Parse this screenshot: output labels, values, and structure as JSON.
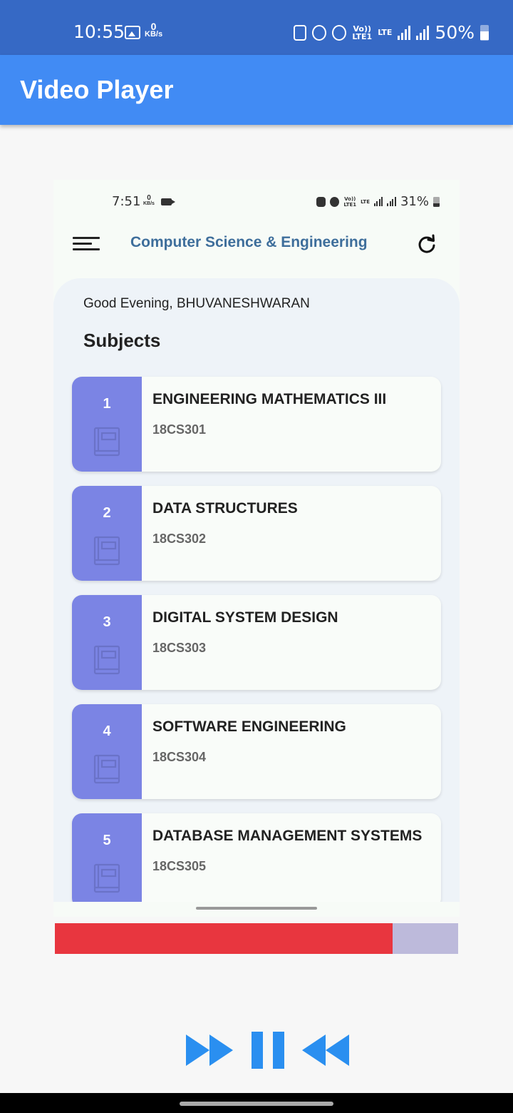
{
  "status_bar": {
    "time": "10:55",
    "data_rate_value": "0",
    "data_rate_unit": "KB/s",
    "network_top": "Vo))",
    "network_bottom": "LTE1",
    "lte": "LTE",
    "battery": "50%"
  },
  "app_bar": {
    "title": "Video Player"
  },
  "video": {
    "status_bar": {
      "time": "7:51",
      "data_rate_value": "0",
      "data_rate_unit": "KB/s",
      "network_top": "Vo))",
      "network_bottom": "LTE1",
      "lte": "LTE",
      "battery": "31%"
    },
    "header": {
      "title": "Computer Science & Engineering"
    },
    "greeting": "Good Evening, BHUVANESHWARAN",
    "section_title": "Subjects",
    "subjects": [
      {
        "number": "1",
        "name": "ENGINEERING MATHEMATICS III",
        "code": "18CS301"
      },
      {
        "number": "2",
        "name": "DATA STRUCTURES",
        "code": "18CS302"
      },
      {
        "number": "3",
        "name": "DIGITAL SYSTEM DESIGN",
        "code": "18CS303"
      },
      {
        "number": "4",
        "name": "SOFTWARE ENGINEERING",
        "code": "18CS304"
      },
      {
        "number": "5",
        "name": "DATABASE MANAGEMENT SYSTEMS",
        "code": "18CS305"
      }
    ]
  },
  "playback": {
    "progress_fraction": 0.838
  },
  "controls": [
    "fast-forward-icon",
    "pause-icon",
    "rewind-icon"
  ],
  "colors": {
    "app_bar": "#418bf4",
    "status_bar": "#3669c5",
    "progress_played": "#e8363f",
    "progress_remaining": "#bdbadb",
    "controls": "#2a8ff0",
    "card_accent": "#7b84e4"
  }
}
